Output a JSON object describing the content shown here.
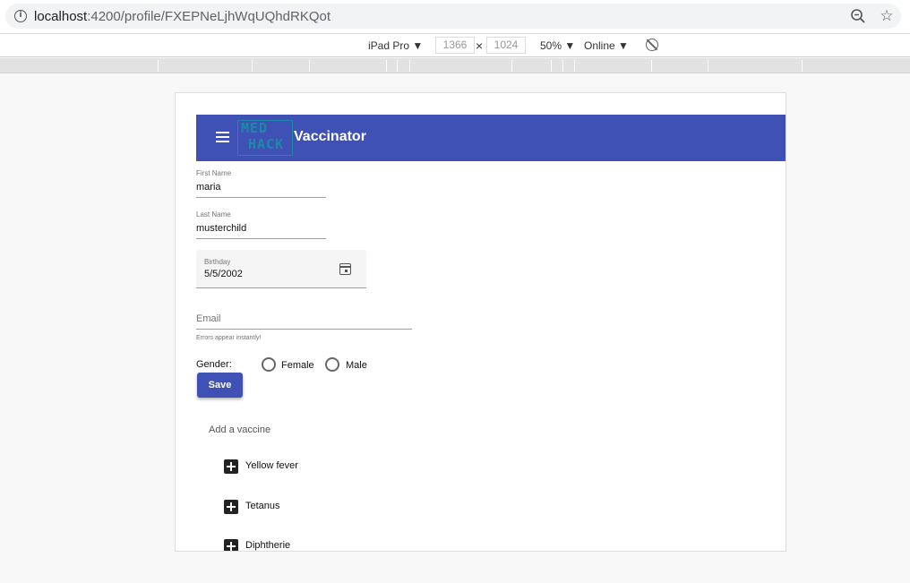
{
  "browser": {
    "url_host": "localhost",
    "url_path": ":4200/profile/FXEPNeLjhWqUQhdRKQot"
  },
  "device_toolbar": {
    "device": "iPad Pro ▼",
    "width": "1366",
    "height": "1024",
    "times": "×",
    "zoom": "50% ▼",
    "network": "Online ▼"
  },
  "app": {
    "logo_line1": "MED",
    "logo_line2": "HACK",
    "title": "Vaccinator"
  },
  "form": {
    "first_name": {
      "label": "First Name",
      "value": "maria"
    },
    "last_name": {
      "label": "Last Name",
      "value": "musterchild"
    },
    "birthday": {
      "label": "Birthday",
      "value": "5/5/2002"
    },
    "email": {
      "placeholder": "Email",
      "hint": "Errors appear instantly!"
    },
    "gender": {
      "label": "Gender:",
      "options": [
        "Female",
        "Male"
      ]
    },
    "save_label": "Save"
  },
  "vaccines": {
    "heading": "Add a vaccine",
    "items": [
      "Yellow fever",
      "Tetanus",
      "Diphtherie"
    ]
  },
  "colors": {
    "primary": "#3f51b5",
    "page_bg": "#f8f8f8"
  }
}
